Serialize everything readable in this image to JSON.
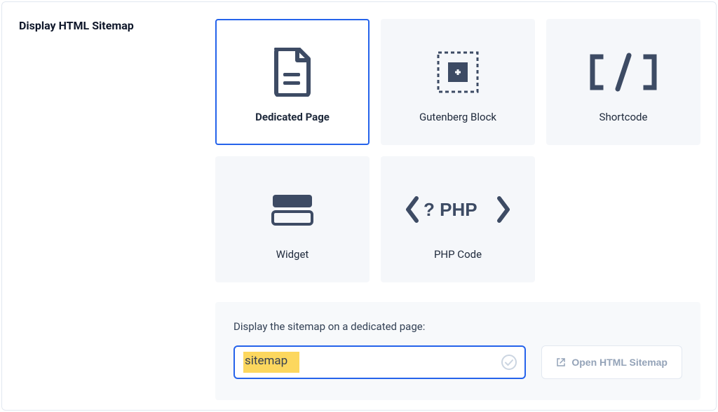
{
  "section_title": "Display HTML Sitemap",
  "tiles": [
    {
      "label": "Dedicated Page"
    },
    {
      "label": "Gutenberg Block"
    },
    {
      "label": "Shortcode"
    },
    {
      "label": "Widget"
    },
    {
      "label": "PHP Code"
    }
  ],
  "settings": {
    "label": "Display the sitemap on a dedicated page:",
    "input_value": "sitemap",
    "open_button": "Open HTML Sitemap"
  }
}
